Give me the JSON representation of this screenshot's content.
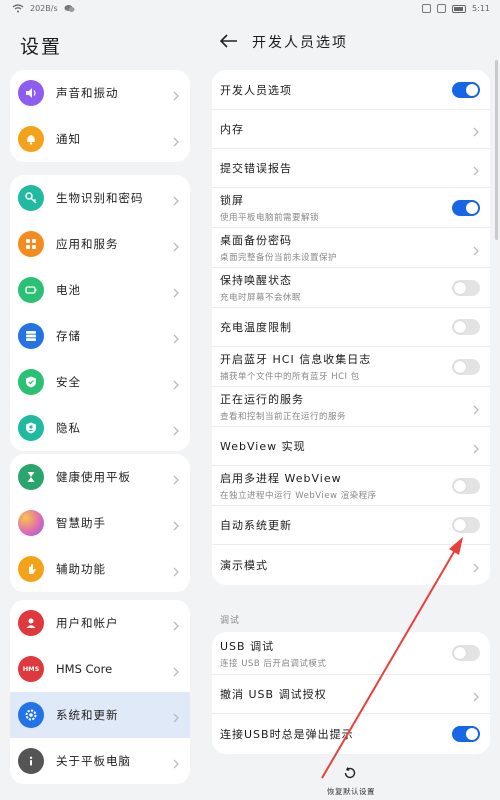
{
  "status": {
    "speed": "202B/s",
    "time": "5:11"
  },
  "left": {
    "title": "设置",
    "groups": [
      [
        {
          "label": "声音和振动",
          "icon": "volume-icon",
          "color": "#8f5cf0"
        },
        {
          "label": "通知",
          "icon": "bell-icon",
          "color": "#f5a21b"
        }
      ],
      [
        {
          "label": "生物识别和密码",
          "icon": "key-icon",
          "color": "#1fbaa0"
        },
        {
          "label": "应用和服务",
          "icon": "apps-icon",
          "color": "#f58a1f"
        },
        {
          "label": "电池",
          "icon": "battery-icon",
          "color": "#2bc174"
        },
        {
          "label": "存储",
          "icon": "storage-icon",
          "color": "#2173e6"
        },
        {
          "label": "安全",
          "icon": "shield-icon",
          "color": "#2bc174"
        },
        {
          "label": "隐私",
          "icon": "privacy-icon",
          "color": "#1fbaa0"
        }
      ],
      [
        {
          "label": "健康使用平板",
          "icon": "hourglass-icon",
          "color": "#2aa56b"
        },
        {
          "label": "智慧助手",
          "icon": "assistant-icon",
          "color": "#e06bb0"
        },
        {
          "label": "辅助功能",
          "icon": "hand-icon",
          "color": "#f5a21b"
        }
      ],
      [
        {
          "label": "用户和帐户",
          "icon": "user-icon",
          "color": "#e0393d"
        },
        {
          "label": "HMS Core",
          "icon": "hms-icon",
          "color": "#e0393d",
          "badge": "HMS"
        },
        {
          "label": "系统和更新",
          "icon": "system-icon",
          "color": "#2173e6"
        },
        {
          "label": "关于平板电脑",
          "icon": "info-icon",
          "color": "#555555"
        }
      ]
    ]
  },
  "right": {
    "title": "开发人员选项",
    "items": [
      {
        "title": "开发人员选项",
        "control": "toggle",
        "on": true
      },
      {
        "title": "内存",
        "control": "chevron"
      },
      {
        "title": "提交错误报告",
        "control": "chevron"
      },
      {
        "title": "锁屏",
        "subtitle": "使用平板电脑前需要解锁",
        "control": "toggle",
        "on": true
      },
      {
        "title": "桌面备份密码",
        "subtitle": "桌面完整备份当前未设置保护",
        "control": "chevron"
      },
      {
        "title": "保持唤醒状态",
        "subtitle": "充电时屏幕不会休眠",
        "control": "toggle",
        "on": false
      },
      {
        "title": "充电温度限制",
        "control": "toggle",
        "on": false
      },
      {
        "title": "开启蓝牙 HCI 信息收集日志",
        "subtitle": "捕获单个文件中的所有蓝牙 HCI 包",
        "control": "toggle",
        "on": false
      },
      {
        "title": "正在运行的服务",
        "subtitle": "查看和控制当前正在运行的服务",
        "control": "chevron"
      },
      {
        "title": "WebView 实现",
        "control": "chevron"
      },
      {
        "title": "启用多进程 WebView",
        "subtitle": "在独立进程中运行 WebView 渲染程序",
        "control": "toggle",
        "on": false
      },
      {
        "title": "自动系统更新",
        "control": "toggle",
        "on": false
      },
      {
        "title": "演示模式",
        "control": "chevron"
      }
    ],
    "section_debug": "调试",
    "debug_items": [
      {
        "title": "USB 调试",
        "subtitle": "连接 USB 后开启调试模式",
        "control": "toggle",
        "on": false
      },
      {
        "title": "撤消 USB 调试授权",
        "control": "chevron"
      },
      {
        "title": "连接USB时总是弹出提示",
        "control": "toggle",
        "on": true
      }
    ],
    "reset_label": "恢复默认设置"
  },
  "colors": {
    "accent": "#1766e6",
    "annotation": "#e8413b"
  }
}
